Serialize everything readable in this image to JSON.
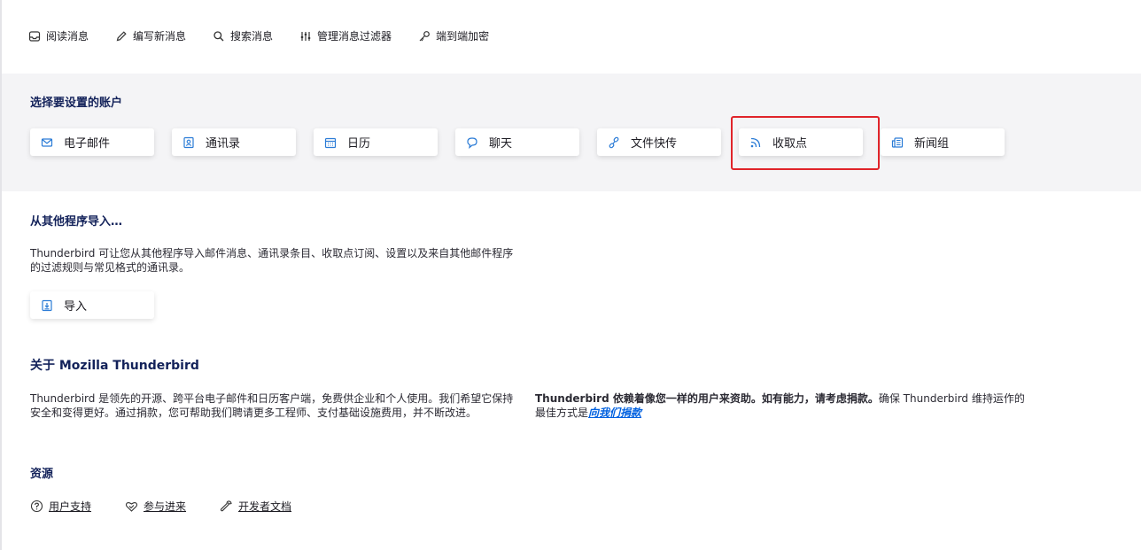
{
  "toolbar": {
    "read": "阅读消息",
    "write": "编写新消息",
    "search": "搜索消息",
    "filters": "管理消息过滤器",
    "e2e": "端到端加密"
  },
  "accounts": {
    "title": "选择要设置的账户",
    "items": [
      {
        "label": "电子邮件",
        "icon": "envelope-icon"
      },
      {
        "label": "通讯录",
        "icon": "address-book-icon"
      },
      {
        "label": "日历",
        "icon": "calendar-icon"
      },
      {
        "label": "聊天",
        "icon": "chat-icon"
      },
      {
        "label": "文件快传",
        "icon": "link-icon"
      },
      {
        "label": "收取点",
        "icon": "rss-icon"
      },
      {
        "label": "新闻组",
        "icon": "newsgroup-icon"
      }
    ]
  },
  "import": {
    "title": "从其他程序导入…",
    "desc_line1": "Thunderbird 可让您从其他程序导入邮件消息、通讯录条目、收取点订阅、设置以及来自其他邮件程序",
    "desc_line2": "的过滤规则与常见格式的通讯录。",
    "button": "导入"
  },
  "about": {
    "title_prefix": "关于 ",
    "title_brand": "Mozilla Thunderbird",
    "left_line1": "Thunderbird 是领先的开源、跨平台电子邮件和日历客户端，免费供企业和个人使用。我们希望它保持",
    "left_line2": "安全和变得更好。通过捐款，您可帮助我们聘请更多工程师、支付基础设施费用，并不断改进。",
    "right_bold": "Thunderbird 依赖着像您一样的用户来资助。如有能力，请考虑捐款。",
    "right_rest": "确保 Thunderbird 维持运作的",
    "right_line2": "最佳方式是",
    "donate_link": "向我们捐款"
  },
  "resources": {
    "title": "资源",
    "support": "用户支持",
    "participate": "参与进来",
    "devdocs": "开发者文档"
  },
  "colors": {
    "accent": "#0061e0",
    "title": "#13225a",
    "highlight": "#e0242a"
  }
}
